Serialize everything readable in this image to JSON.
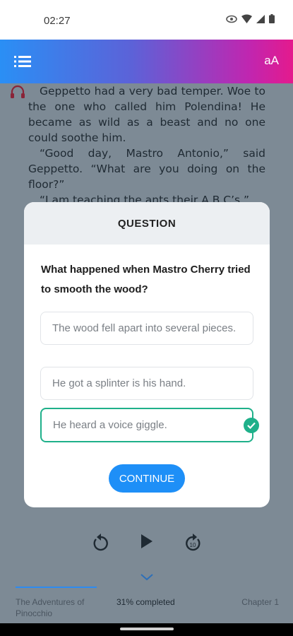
{
  "status": {
    "time": "02:27"
  },
  "app_bar": {
    "font_label": "aA"
  },
  "story": {
    "paragraphs": [
      "Geppetto had a very bad temper. Woe to the one who called him Polendina! He became as wild as a beast and no one could soothe him.",
      "“Good day, Mastro Antonio,” said Geppetto. “What are you doing on the floor?”",
      "“I am teaching the ants their A B C’s.”"
    ]
  },
  "question": {
    "header": "QUESTION",
    "text": "What happened when Mastro Cherry tried to smooth the wood?",
    "options": [
      "The wood fell apart into several pieces.",
      "He got a splinter is his hand.",
      "He heard a voice giggle."
    ],
    "continue_label": "CONTINUE"
  },
  "player": {
    "skip_label": "10"
  },
  "bottom": {
    "title": "The Adventures of Pinocchio",
    "progress": "31% completed",
    "chapter": "Chapter 1"
  },
  "colors": {
    "accent": "#1e8ff7",
    "correct": "#1fb08a",
    "gradient_start": "#2a8ff5",
    "gradient_end": "#e41a8d"
  }
}
